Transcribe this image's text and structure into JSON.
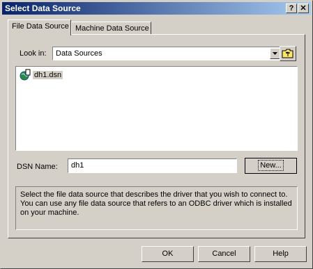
{
  "window": {
    "title": "Select Data Source"
  },
  "titlebar_buttons": {
    "help": "?",
    "close": "✕"
  },
  "tabs": [
    {
      "label": "File Data Source"
    },
    {
      "label": "Machine Data Source"
    }
  ],
  "look_in": {
    "label": "Look in:",
    "value": "Data Sources"
  },
  "file_list": {
    "items": [
      {
        "name": "dh1.dsn"
      }
    ]
  },
  "dsn": {
    "label": "DSN Name:",
    "value": "dh1"
  },
  "buttons": {
    "new": "New...",
    "ok": "OK",
    "cancel": "Cancel",
    "help": "Help"
  },
  "description": "Select the file data source that describes the driver that you wish to connect to. You can use any file data source that refers to an ODBC driver which is installed on your machine."
}
